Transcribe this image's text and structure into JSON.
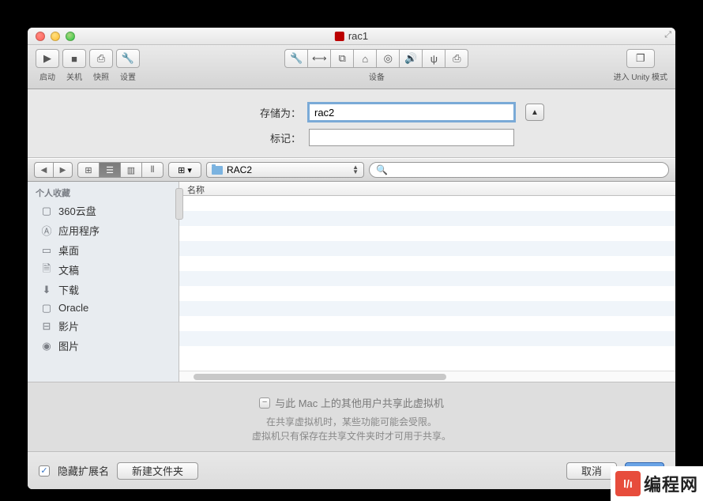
{
  "window": {
    "title": "rac1"
  },
  "toolbar": {
    "buttons": {
      "start": "启动",
      "shutdown": "关机",
      "snapshot": "快照",
      "settings": "设置"
    },
    "devices_label": "设备",
    "unity_label": "进入 Unity 模式"
  },
  "save": {
    "name_label": "存储为：",
    "name_value": "rac2",
    "tags_label": "标记：",
    "tags_value": ""
  },
  "browser": {
    "path_selected": "RAC2",
    "search_placeholder": "",
    "column_header": "名称"
  },
  "sidebar": {
    "section": "个人收藏",
    "items": [
      {
        "label": "360云盘",
        "icon": "folder"
      },
      {
        "label": "应用程序",
        "icon": "apps"
      },
      {
        "label": "桌面",
        "icon": "desktop"
      },
      {
        "label": "文稿",
        "icon": "documents"
      },
      {
        "label": "下载",
        "icon": "download"
      },
      {
        "label": "Oracle",
        "icon": "folder"
      },
      {
        "label": "影片",
        "icon": "movies"
      },
      {
        "label": "图片",
        "icon": "pictures"
      }
    ]
  },
  "share": {
    "title": "与此 Mac 上的其他用户共享此虚拟机",
    "line1": "在共享虚拟机时，某些功能可能会受限。",
    "line2": "虚拟机只有保存在共享文件夹时才可用于共享。"
  },
  "bottom": {
    "hide_ext": "隐藏扩展名",
    "new_folder": "新建文件夹",
    "cancel": "取消",
    "save": ""
  },
  "watermark": {
    "text": "编程网"
  }
}
